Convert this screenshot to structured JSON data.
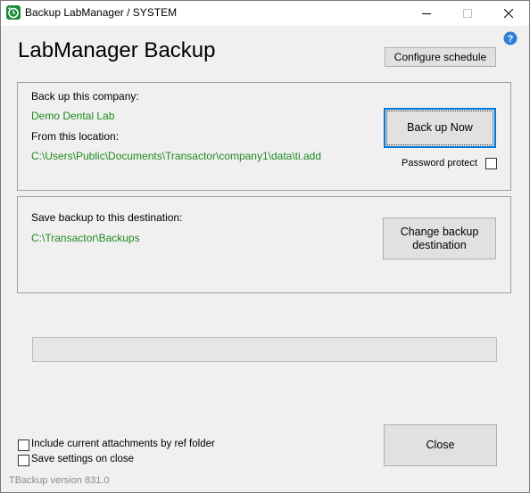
{
  "window": {
    "title": "Backup LabManager / SYSTEM",
    "minimize_glyph": "—",
    "maximize_glyph": "☐",
    "close_glyph": "✕"
  },
  "header": {
    "app_title": "LabManager Backup",
    "configure_schedule_label": "Configure schedule"
  },
  "source": {
    "company_caption": "Back up this company:",
    "company_name": "Demo Dental Lab",
    "location_caption": "From this location:",
    "location_path": "C:\\Users\\Public\\Documents\\Transactor\\company1\\data\\ti.add",
    "backup_now_label": "Back up Now",
    "password_protect_label": "Password protect",
    "password_protect_checked": false
  },
  "destination": {
    "caption": "Save backup to this destination:",
    "path": "C:\\Transactor\\Backups",
    "change_label_line1": "Change backup",
    "change_label_line2": "destination"
  },
  "progress": {
    "value_fraction": 0
  },
  "options": {
    "include_attachments_label": "Include current attachments by ref folder",
    "include_attachments_checked": false,
    "save_settings_label": "Save settings on close",
    "save_settings_checked": false
  },
  "footer": {
    "close_label": "Close",
    "version_text": "TBackup version 831.0"
  },
  "colors": {
    "accent_green": "#1f8a1f",
    "focus_blue": "#0078d7",
    "app_icon_green": "#1e8a3c"
  },
  "icons": {
    "app": "clock-arrow-icon",
    "help": "question-mark-icon"
  }
}
